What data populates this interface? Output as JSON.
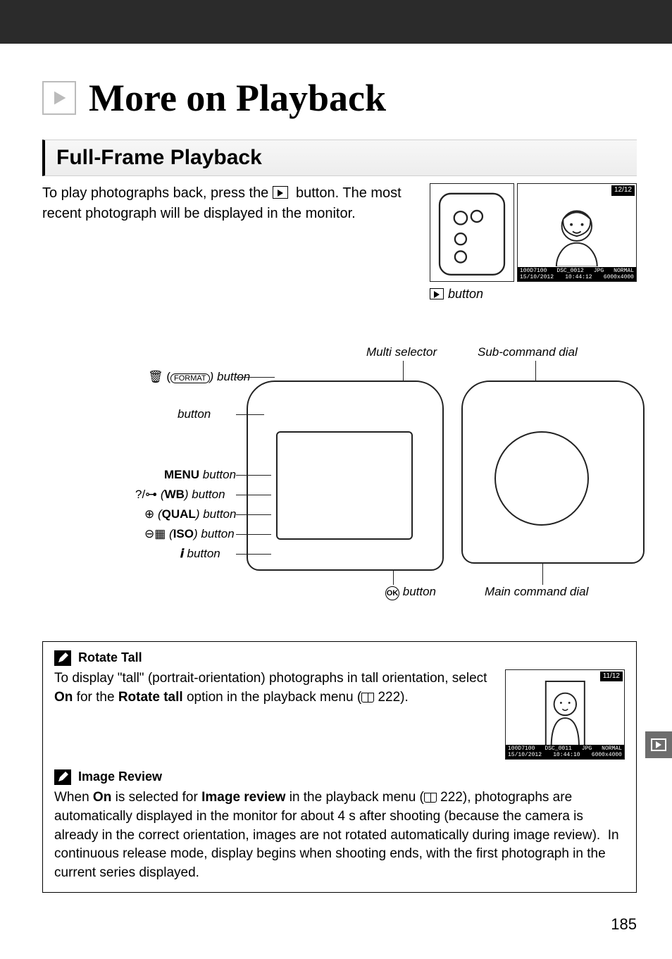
{
  "chapter": {
    "title": "More on Playback"
  },
  "subheading": "Full-Frame Playback",
  "intro": {
    "before_icon": "To play photographs back, press the ",
    "after_icon": " button. The most recent photograph will be displayed in the monitor."
  },
  "caption_button": "button",
  "monitor1": {
    "counter": "12/12",
    "folder": "100D7100",
    "file": "DSC_0012",
    "ext": "JPG",
    "date": "15/10/2012",
    "time": "10:44:12",
    "quality": "NORMAL",
    "size": "6000x4000"
  },
  "diagram_labels": {
    "multi_selector": "Multi selector",
    "sub_command_dial": "Sub-command dial",
    "main_command_dial": "Main command dial",
    "ok_button": "button",
    "delete_button": ") button",
    "delete_prefix": "O (",
    "delete_format": "FORMAT",
    "play_button": "button",
    "menu_label": "MENU",
    "menu_button": " button",
    "wb_prefix": "?/",
    "wb_bold": "WB",
    "wb_suffix": ") button",
    "qual_bold": "QUAL",
    "qual_suffix": ") button",
    "iso_bold": "ISO",
    "iso_suffix": ") button",
    "info_button": "button"
  },
  "notes": {
    "rotate_tall_title": "Rotate Tall",
    "rotate_tall_body_1": "To display \"tall\" (portrait-orientation) photographs in tall orientation, select ",
    "rotate_tall_on": "On",
    "rotate_tall_body_2": " for the ",
    "rotate_tall_opt": "Rotate tall",
    "rotate_tall_body_3": " option in the playback menu (",
    "rotate_tall_ref": " 222).",
    "image_review_title": "Image Review",
    "image_review_body_1": "When ",
    "image_review_on": "On",
    "image_review_body_2": " is selected for ",
    "image_review_opt": "Image review",
    "image_review_body_3": " in the playback menu (",
    "image_review_ref": " 222), photographs are automatically displayed in the monitor for about 4 s after shooting (because the camera is already in the correct orientation, images are not rotated automatically during image review).  In continuous release mode, display begins when shooting ends, with the first photograph in the current series displayed."
  },
  "monitor2": {
    "counter": "11/12",
    "folder": "100D7100",
    "file": "DSC_0011",
    "ext": "JPG",
    "date": "15/10/2012",
    "time": "10:44:10",
    "quality": "NORMAL",
    "size": "6000x4000"
  },
  "page_number": "185"
}
